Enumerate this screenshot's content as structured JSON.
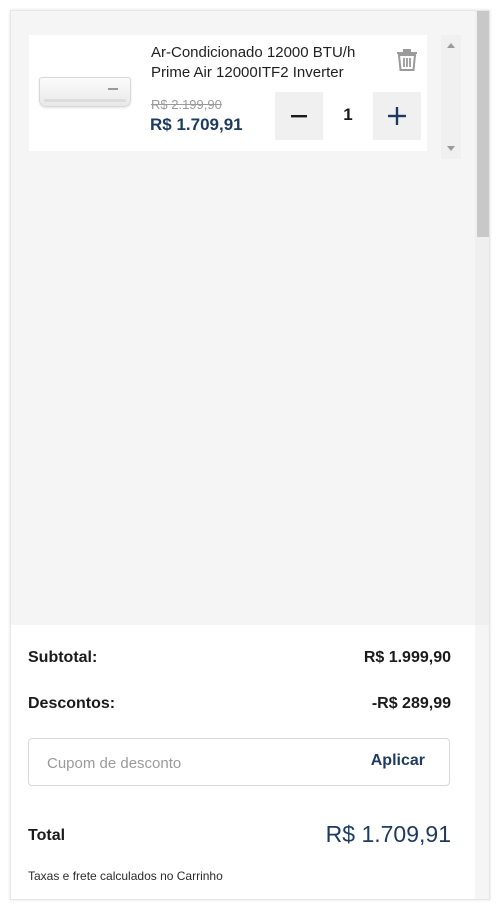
{
  "cart": {
    "items": [
      {
        "name": "Ar-Condicionado 12000 BTU/h Prime Air 12000ITF2 Inverter",
        "old_price": "R$ 2.199,90",
        "price": "R$ 1.709,91",
        "quantity": "1",
        "image_icon": "air-conditioner-image",
        "remove_icon": "trash-icon",
        "decrease_icon": "minus-icon",
        "increase_icon": "plus-icon"
      }
    ]
  },
  "summary": {
    "subtotal_label": "Subtotal:",
    "subtotal_value": "R$ 1.999,90",
    "discount_label": "Descontos:",
    "discount_value": "-R$ 289,99",
    "coupon_placeholder": "Cupom de desconto",
    "apply_label": "Aplicar",
    "total_label": "Total",
    "total_value": "R$ 1.709,91",
    "note": "Taxas e frete calculados no Carrinho"
  },
  "colors": {
    "brand_navy": "#1d3a5f",
    "panel_bg": "#f5f5f5",
    "muted_text": "#9a9a9a"
  }
}
